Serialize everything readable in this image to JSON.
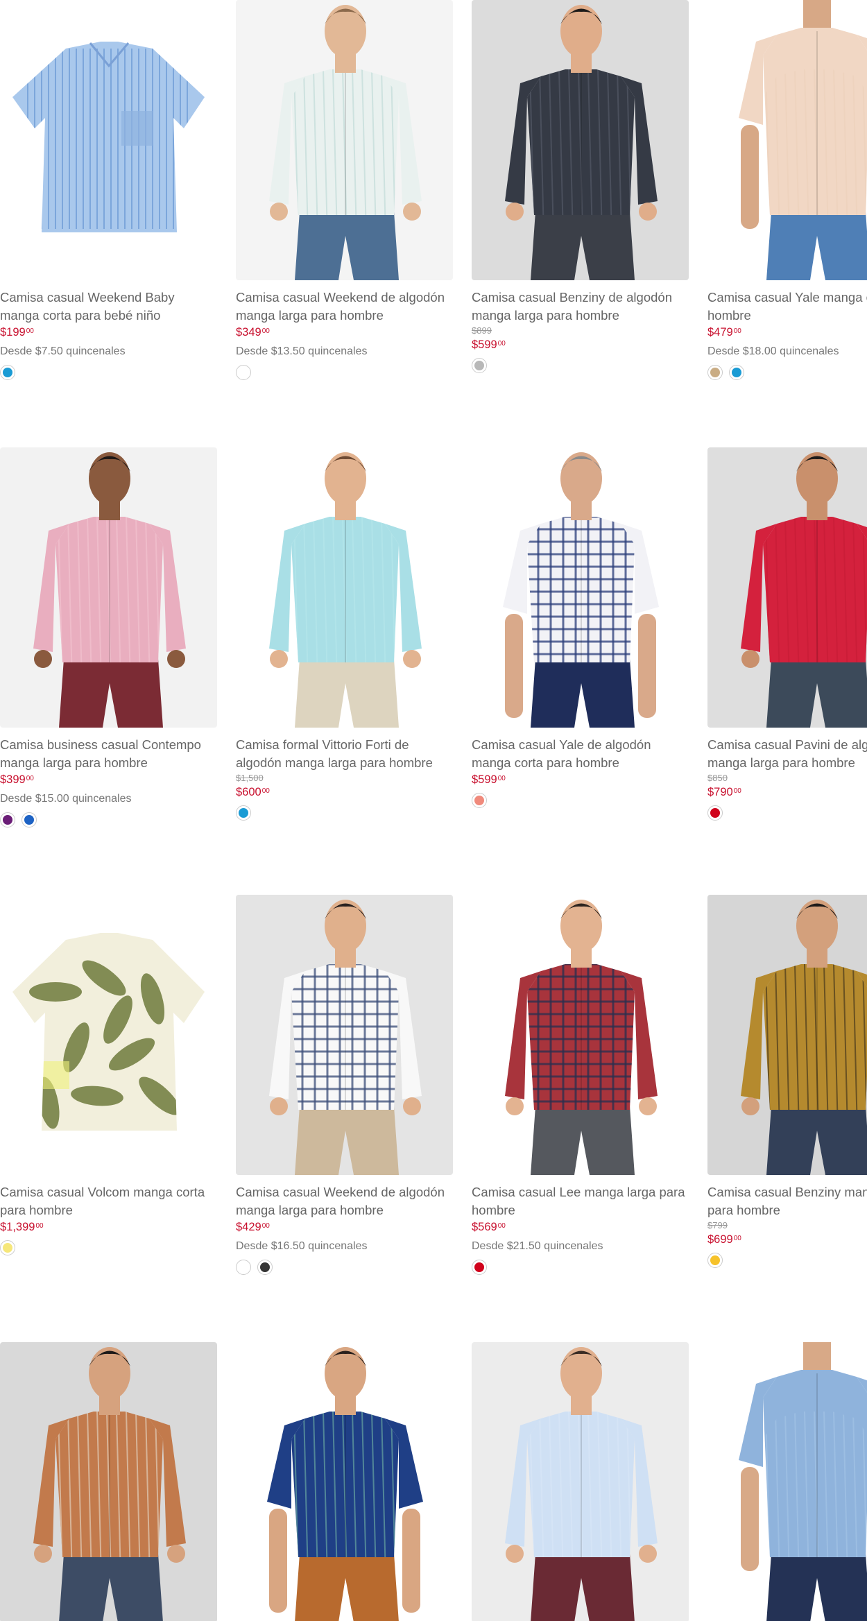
{
  "products": [
    {
      "title": "Camisa casual Weekend Baby manga corta para bebé niño",
      "old_price": "",
      "price_main": "$199",
      "price_cents": "00",
      "installments": "Desde $7.50 quincenales",
      "swatches": [
        "#1a9bd4"
      ],
      "image": {
        "bg": "#ffffff",
        "shirt": "#a9c8ec",
        "stripe": "#ffffff",
        "type": "flat-short"
      }
    },
    {
      "title": "Camisa casual Weekend de algodón manga larga para hombre",
      "old_price": "",
      "price_main": "$349",
      "price_cents": "00",
      "installments": "Desde $13.50 quincenales",
      "swatches": [
        "#ffffff"
      ],
      "image": {
        "bg": "#f4f4f4",
        "shirt": "#e9f1ef",
        "stripe": "#b7d6d2",
        "pants": "#4d6f94",
        "skin": "#e2b896",
        "hair": "#8c6a4c",
        "type": "model-long"
      }
    },
    {
      "title": "Camisa casual Benziny de algodón manga larga para hombre",
      "old_price": "$899",
      "price_main": "$599",
      "price_cents": "00",
      "installments": "",
      "swatches": [
        "#b8b8b8"
      ],
      "image": {
        "bg": "#dcdcdc",
        "shirt": "#353a45",
        "stripe": "#5b6170",
        "pants": "#3b3f48",
        "skin": "#e0ad8a",
        "hair": "#1d1b1a",
        "type": "model-long"
      }
    },
    {
      "title": "Camisa casual Yale manga corta para hombre",
      "old_price": "",
      "price_main": "$479",
      "price_cents": "00",
      "installments": "Desde $18.00 quincenales",
      "swatches": [
        "#c9ac84",
        "#1a9bd4"
      ],
      "image": {
        "bg": "#ffffff",
        "shirt": "#f1d7c4",
        "stripe": "#ecd0bb",
        "pants": "#4f7fb6",
        "skin": "#d7a886",
        "hair": "#6c6c6c",
        "type": "model-short-crop"
      }
    },
    {
      "title": "Camisa business casual Contempo manga larga para hombre",
      "old_price": "",
      "price_main": "$399",
      "price_cents": "00",
      "installments": "Desde $15.00 quincenales",
      "swatches": [
        "#6b1e77",
        "#1e63c4"
      ],
      "image": {
        "bg": "#f2f2f2",
        "shirt": "#e9aebf",
        "stripe": "#f4c9d4",
        "pants": "#7b2b34",
        "skin": "#8a5a3e",
        "hair": "#1d1715",
        "type": "model-long"
      }
    },
    {
      "title": "Camisa formal Vittorio Forti de algodón manga larga para hombre",
      "old_price": "$1,500",
      "price_main": "$600",
      "price_cents": "00",
      "installments": "",
      "swatches": [
        "#1a9bd4"
      ],
      "image": {
        "bg": "#ffffff",
        "shirt": "#a9dfe6",
        "stripe": "#b9e7ec",
        "pants": "#ddd4bf",
        "skin": "#e2b390",
        "hair": "#6e4a33",
        "type": "model-long"
      }
    },
    {
      "title": "Camisa casual Yale de algodón manga corta para hombre",
      "old_price": "",
      "price_main": "$599",
      "price_cents": "00",
      "installments": "",
      "swatches": [
        "#f08a7c"
      ],
      "image": {
        "bg": "#ffffff",
        "shirt": "#f2f2f6",
        "stripe": "#2b3e7a",
        "pants": "#1f2d5a",
        "skin": "#d9a98a",
        "hair": "#8a8a8a",
        "type": "model-short-check"
      }
    },
    {
      "title": "Camisa casual Pavini de algodón manga larga para hombre",
      "old_price": "$850",
      "price_main": "$790",
      "price_cents": "00",
      "installments": "",
      "swatches": [
        "#d0021b"
      ],
      "image": {
        "bg": "#dedede",
        "shirt": "#d4213d",
        "stripe": "#c41c35",
        "pants": "#3c4a5a",
        "skin": "#c9906c",
        "hair": "#1d1a19",
        "type": "model-long"
      }
    },
    {
      "title": "Camisa casual Volcom manga corta para hombre",
      "old_price": "",
      "price_main": "$1,399",
      "price_cents": "00",
      "installments": "",
      "swatches": [
        "#f6e77a"
      ],
      "image": {
        "bg": "#ffffff",
        "shirt": "#f2efdc",
        "stripe": "#6f7a3c",
        "type": "flat-tropical"
      }
    },
    {
      "title": "Camisa casual Weekend de algodón manga larga para hombre",
      "old_price": "",
      "price_main": "$429",
      "price_cents": "00",
      "installments": "Desde $16.50 quincenales",
      "swatches": [
        "#ffffff",
        "#333333"
      ],
      "image": {
        "bg": "#e4e4e4",
        "shirt": "#f8f8f8",
        "stripe": "#3c4f7a",
        "pants": "#cdb99c",
        "skin": "#e0b08c",
        "hair": "#2a2220",
        "type": "model-long-check"
      }
    },
    {
      "title": "Camisa casual Lee manga larga para hombre",
      "old_price": "",
      "price_main": "$569",
      "price_cents": "00",
      "installments": "Desde $21.50 quincenales",
      "swatches": [
        "#d0021b"
      ],
      "image": {
        "bg": "#ffffff",
        "shirt": "#a8343c",
        "stripe": "#2a2f4f",
        "pants": "#55585e",
        "skin": "#e3b391",
        "hair": "#2d241f",
        "type": "model-long-check"
      }
    },
    {
      "title": "Camisa casual Benziny manga larga para hombre",
      "old_price": "$799",
      "price_main": "$699",
      "price_cents": "00",
      "installments": "",
      "swatches": [
        "#f6c22a"
      ],
      "image": {
        "bg": "#d6d6d6",
        "shirt": "#b58a2e",
        "stripe": "#2a2418",
        "pants": "#334058",
        "skin": "#d3a07c",
        "hair": "#1d1a19",
        "type": "model-long"
      }
    },
    {
      "title": "",
      "old_price": "",
      "price_main": "",
      "price_cents": "",
      "installments": "",
      "swatches": [],
      "image": {
        "bg": "#d9d9d9",
        "shirt": "#c27a4c",
        "stripe": "#e9e3d7",
        "pants": "#3d4c65",
        "skin": "#d6a27e",
        "hair": "#1d1a19",
        "type": "model-long"
      }
    },
    {
      "title": "",
      "old_price": "",
      "price_main": "",
      "price_cents": "",
      "installments": "",
      "swatches": [],
      "image": {
        "bg": "#ffffff",
        "shirt": "#1f3f86",
        "stripe": "#7bc1a8",
        "pants": "#b86a2e",
        "skin": "#d9a682",
        "hair": "#2a211d",
        "type": "model-short"
      }
    },
    {
      "title": "",
      "old_price": "",
      "price_main": "",
      "price_cents": "",
      "installments": "",
      "swatches": [],
      "image": {
        "bg": "#ececec",
        "shirt": "#cfe0f4",
        "stripe": "#dbe8f7",
        "pants": "#6a2a34",
        "skin": "#e1b08e",
        "hair": "#3a2c24",
        "type": "model-long"
      }
    },
    {
      "title": "",
      "old_price": "",
      "price_main": "",
      "price_cents": "",
      "installments": "",
      "swatches": [],
      "image": {
        "bg": "#ffffff",
        "shirt": "#8fb3dc",
        "stripe": "#a8c6e8",
        "pants": "#243255",
        "skin": "#d8a987",
        "hair": "#4a3a30",
        "type": "model-short-crop"
      }
    }
  ]
}
